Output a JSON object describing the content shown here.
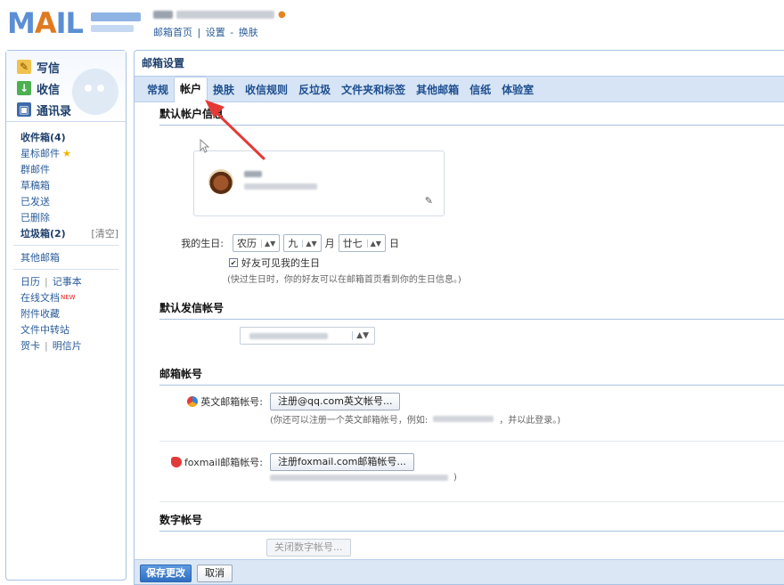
{
  "header": {
    "logo_text": "MAIL",
    "logo_ai": "I",
    "nav_home": "邮箱首页",
    "nav_sep": "|",
    "nav_settings": "设置",
    "nav_dash": "-",
    "nav_skin": "换肤"
  },
  "sidebar": {
    "write": "写信",
    "inbox": "收信",
    "contacts": "通讯录",
    "folders": [
      {
        "label": "收件箱(4)",
        "bold": true
      },
      {
        "label": "星标邮件",
        "star": "★"
      },
      {
        "label": "群邮件"
      },
      {
        "label": "草稿箱"
      },
      {
        "label": "已发送"
      },
      {
        "label": "已删除"
      },
      {
        "label": "垃圾箱(2)",
        "bold": true,
        "extra": "[清空]"
      }
    ],
    "other_mailbox": "其他邮箱",
    "tools": {
      "calendar": "日历",
      "sep": "|",
      "notes": "记事本",
      "online_docs": "在线文档",
      "new_badge": "NEW",
      "attachments": "附件收藏",
      "transfer": "文件中转站",
      "cards": "贺卡",
      "postcards": "明信片"
    }
  },
  "main": {
    "title": "邮箱设置",
    "tabs": [
      "常规",
      "帐户",
      "换肤",
      "收信规则",
      "反垃圾",
      "文件夹和标签",
      "其他邮箱",
      "信纸",
      "体验室"
    ],
    "active_tab": 1,
    "sections": {
      "default_info": "默认帐户信息",
      "default_sender": "默认发信帐号",
      "mail_accounts": "邮箱帐号",
      "digital_account": "数字帐号"
    },
    "birthday": {
      "label": "我的生日:",
      "calendar": "农历",
      "month": "九",
      "month_unit": "月",
      "day": "廿七",
      "day_unit": "日",
      "checkbox_label": "好友可见我的生日",
      "hint": "(快过生日时，你的好友可以在邮箱首页看到你的生日信息。)"
    },
    "english_account": {
      "label": "英文邮箱帐号:",
      "button": "注册@qq.com英文帐号...",
      "hint_prefix": "(你还可以注册一个英文邮箱帐号，例如:",
      "hint_suffix": "，并以此登录。)"
    },
    "foxmail_account": {
      "label": "foxmail邮箱帐号:",
      "button": "注册foxmail.com邮箱帐号...",
      "hint_suffix": ")"
    },
    "digital": {
      "button": "关闭数字帐号..."
    },
    "footer": {
      "save": "保存更改",
      "cancel": "取消"
    }
  },
  "colors": {
    "accent_blue": "#2f6fc1",
    "tab_bar": "#d6e4f5",
    "annotation_arrow": "#e53935"
  }
}
